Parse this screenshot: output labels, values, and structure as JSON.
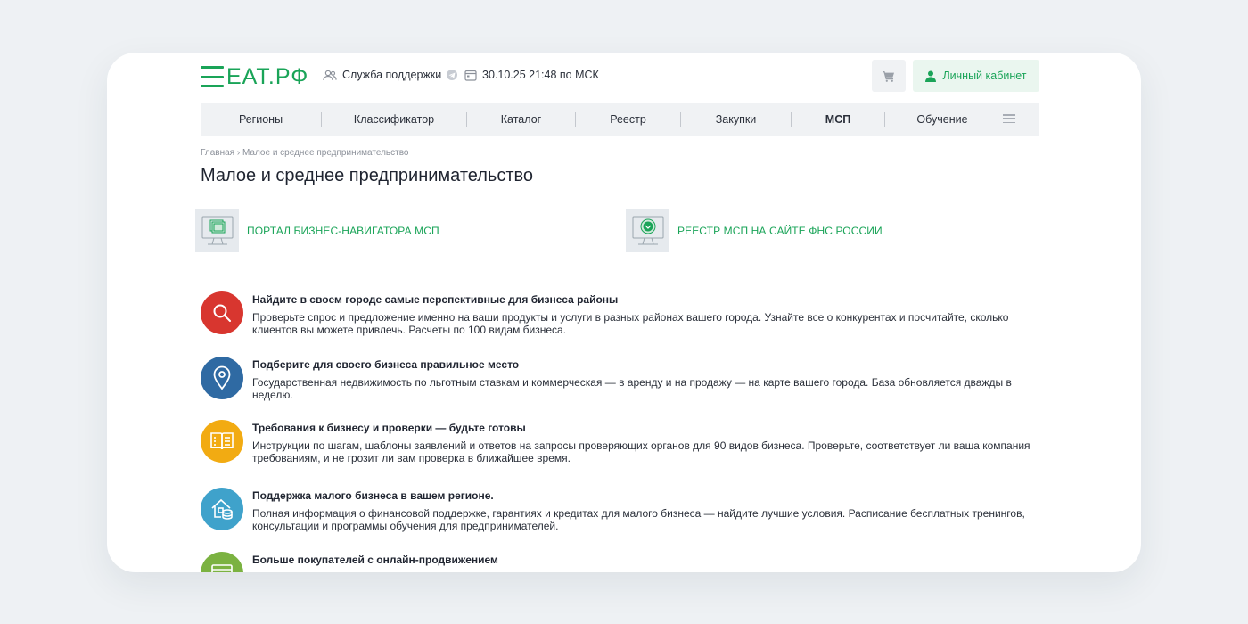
{
  "header": {
    "logo_text": "ЕАТ.РФ",
    "support_label": "Служба поддержки",
    "datetime": "30.10.25 21:48 по МСК",
    "cabinet_label": "Личный кабинет"
  },
  "nav": {
    "items": [
      {
        "label": "Регионы",
        "active": false
      },
      {
        "label": "Классификатор",
        "active": false
      },
      {
        "label": "Каталог",
        "active": false
      },
      {
        "label": "Реестр",
        "active": false
      },
      {
        "label": "Закупки",
        "active": false
      },
      {
        "label": "МСП",
        "active": true
      },
      {
        "label": "Обучение",
        "active": false
      }
    ]
  },
  "breadcrumb": {
    "home": "Главная",
    "separator": "›",
    "current": "Малое и среднее предпринимательство"
  },
  "page": {
    "title": "Малое и среднее предпринимательство"
  },
  "portals": [
    {
      "label": "ПОРТАЛ БИЗНЕС-НАВИГАТОРА МСП",
      "icon": "monitor-layers-icon"
    },
    {
      "label": "РЕЕСТР МСП НА САЙТЕ ФНС РОССИИ",
      "icon": "monitor-emblem-icon"
    }
  ],
  "features": [
    {
      "title": "Найдите в своем городе самые перспективные для бизнеса районы",
      "description": "Проверьте спрос и предложение именно на ваши продукты и услуги в разных районах вашего города. Узнайте все о конкурентах и посчитайте, сколько клиентов вы можете привлечь. Расчеты по 100 видам бизнеса.",
      "icon": "search-icon",
      "color": "#d8362f"
    },
    {
      "title": "Подберите для своего бизнеса правильное место",
      "description": "Государственная недвижимость по льготным ставкам и коммерческая — в аренду и на продажу — на карте вашего города. База обновляется дважды в неделю.",
      "icon": "map-pin-icon",
      "color": "#2f6aa3"
    },
    {
      "title": "Требования к бизнесу и проверки — будьте готовы",
      "description": "Инструкции по шагам, шаблоны заявлений и ответов на запросы проверяющих органов для 90 видов бизнеса. Проверьте, соответствует ли ваша компания требованиям, и не грозит ли вам проверка в ближайшее время.",
      "icon": "open-book-icon",
      "color": "#f2ab12"
    },
    {
      "title": "Поддержка малого бизнеса в вашем регионе.",
      "description": "Полная информация о финансовой поддержке, гарантиях и кредитах для малого бизнеса — найдите лучшие условия. Расписание бесплатных тренингов, консультации и программы обучения для предпринимателей.",
      "icon": "house-coins-icon",
      "color": "#3fa2cb"
    },
    {
      "title": "Больше покупателей с онлайн-продвижением",
      "description": "",
      "icon": "browser-window-icon",
      "color": "#7bb241"
    }
  ],
  "colors": {
    "brand": "#1aa458",
    "nav_background": "#f0f2f4",
    "page_background": "#eef1f4"
  }
}
